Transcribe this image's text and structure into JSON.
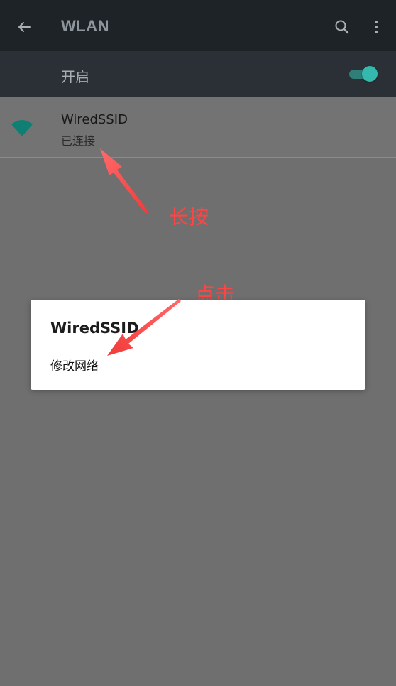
{
  "app_bar": {
    "title": "WLAN"
  },
  "wifi_switch": {
    "label": "开启",
    "enabled": true
  },
  "network": {
    "name": "WiredSSID",
    "status": "已连接"
  },
  "dialog": {
    "title": "WiredSSID",
    "option": "修改网络"
  },
  "annotations": {
    "long_press": "长按",
    "tap": "点击"
  },
  "colors": {
    "toolbar": "#1e2328",
    "switch_row": "#2a3035",
    "accent": "#35b8ad",
    "annotation": "#ff4444"
  },
  "icons": {
    "back": "arrow-left-icon",
    "search": "search-icon",
    "more": "more-vertical-icon",
    "wifi": "wifi-icon",
    "arrow": "annotation-arrow-icon"
  }
}
